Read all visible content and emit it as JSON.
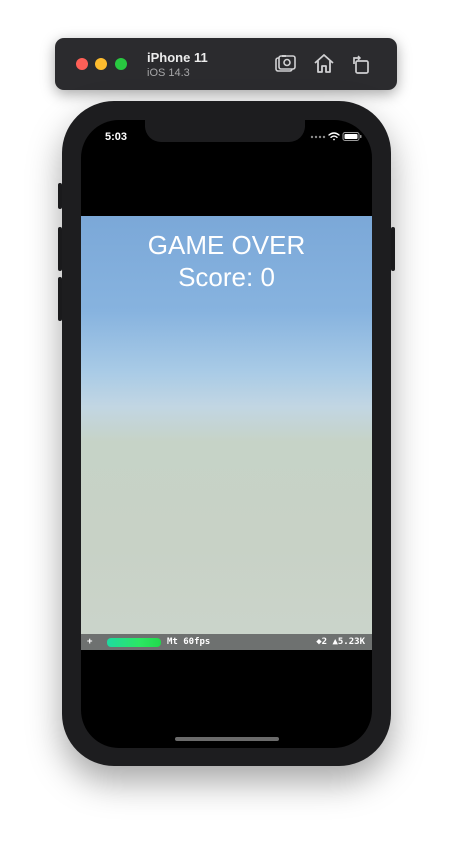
{
  "simulator": {
    "device_name": "iPhone 11",
    "os_version": "iOS 14.3",
    "icons": [
      "screenshot-icon",
      "home-icon",
      "rotate-icon"
    ]
  },
  "status_bar": {
    "time": "5:03",
    "icons": [
      "signal-dots-icon",
      "wifi-icon",
      "battery-icon"
    ]
  },
  "game": {
    "title": "GAME OVER",
    "score_label": "Score:",
    "score_value": "0"
  },
  "stats": {
    "plus": "+",
    "fps_label": "Mt 60fps",
    "node_stats": "◆2 ▲5.23K",
    "fps_bar_color": "#2be864"
  },
  "colors": {
    "sky_top": "#7ba8d8",
    "ground": "#c8d2c6",
    "phone_body": "#1d1d1f"
  }
}
